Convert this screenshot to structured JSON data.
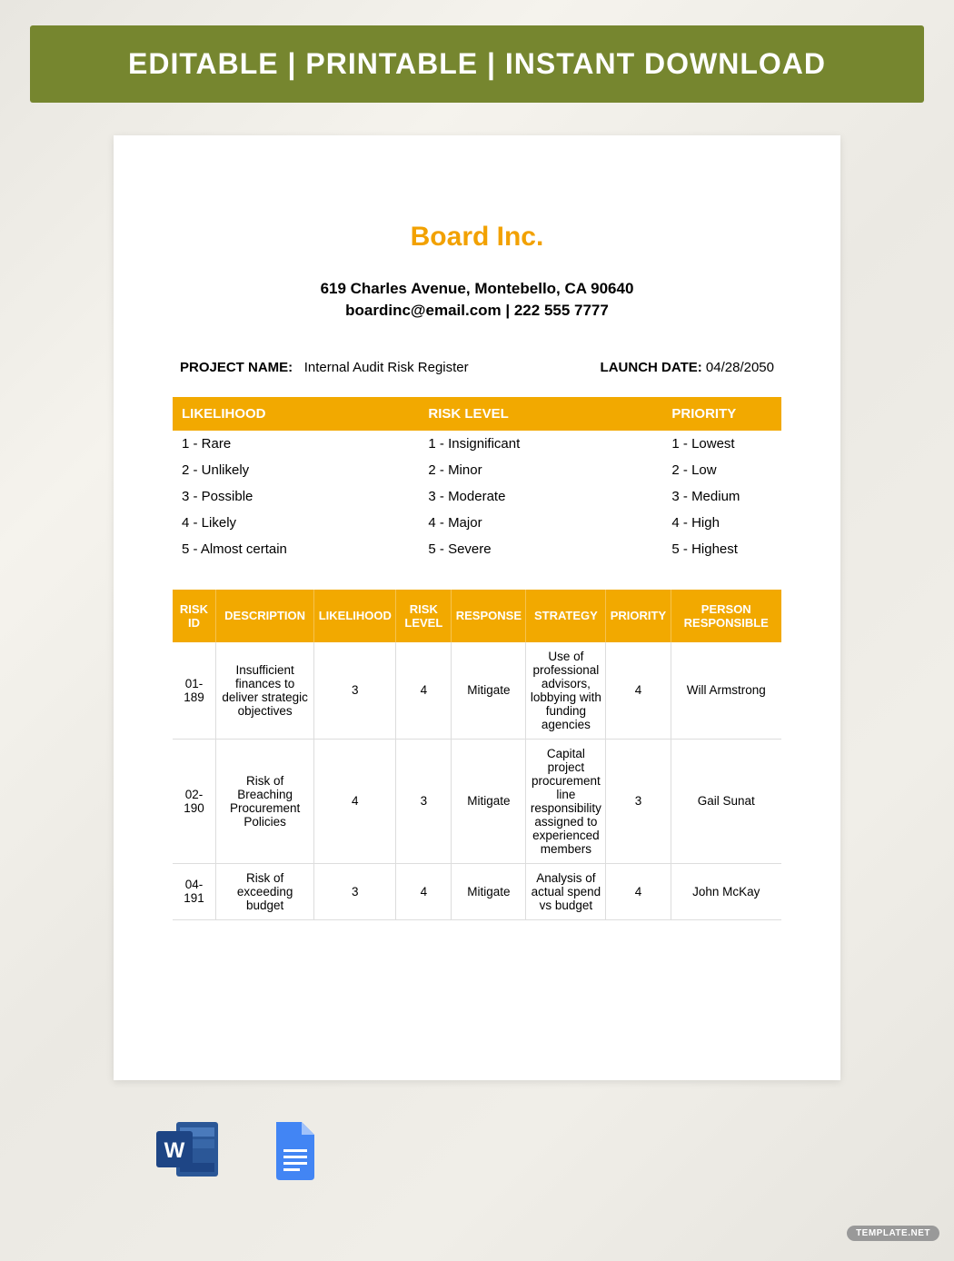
{
  "banner": "EDITABLE  |  PRINTABLE  |  INSTANT DOWNLOAD",
  "company": "Board Inc.",
  "address": "619 Charles Avenue, Montebello, CA 90640",
  "contact": "boardinc@email.com | 222 555 7777",
  "project_label": "PROJECT NAME:",
  "project_value": "Internal Audit Risk Register",
  "launch_label": "LAUNCH DATE:",
  "launch_value": "04/28/2050",
  "legend": {
    "headers": [
      "LIKELIHOOD",
      "RISK LEVEL",
      "PRIORITY"
    ],
    "rows": [
      [
        "1 - Rare",
        "1 - Insignificant",
        "1 - Lowest"
      ],
      [
        "2 - Unlikely",
        "2 - Minor",
        "2 - Low"
      ],
      [
        "3 - Possible",
        "3 - Moderate",
        "3 - Medium"
      ],
      [
        "4 - Likely",
        "4 - Major",
        "4 - High"
      ],
      [
        "5 - Almost certain",
        "5 - Severe",
        "5 - Highest"
      ]
    ]
  },
  "risk": {
    "headers": [
      "RISK ID",
      "DESCRIPTION",
      "LIKELIHOOD",
      "RISK LEVEL",
      "RESPONSE",
      "STRATEGY",
      "PRIORITY",
      "PERSON RESPONSIBLE"
    ],
    "rows": [
      {
        "id": "01-189",
        "desc": "Insufficient finances to deliver strategic objectives",
        "like": "3",
        "level": "4",
        "resp": "Mitigate",
        "strat": "Use of professional advisors, lobbying with funding agencies",
        "prio": "4",
        "person": "Will Armstrong"
      },
      {
        "id": "02-190",
        "desc": "Risk of Breaching Procurement Policies",
        "like": "4",
        "level": "3",
        "resp": "Mitigate",
        "strat": "Capital project procurement line responsibility assigned to experienced members",
        "prio": "3",
        "person": "Gail Sunat"
      },
      {
        "id": "04-191",
        "desc": "Risk of exceeding budget",
        "like": "3",
        "level": "4",
        "resp": "Mitigate",
        "strat": "Analysis of actual spend vs budget",
        "prio": "4",
        "person": "John McKay"
      }
    ]
  },
  "watermark": "TEMPLATE.NET"
}
